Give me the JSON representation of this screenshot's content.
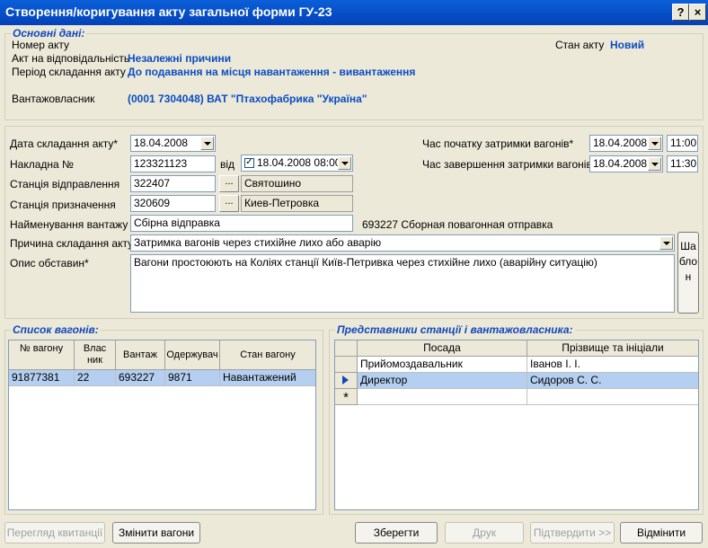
{
  "window": {
    "title": "Створення/коригування акту загальної форми ГУ-23",
    "help_label": "?",
    "close_label": "×"
  },
  "main_info": {
    "legend": "Основні дані:",
    "act_number_label": "Номер акту",
    "act_state_label": "Стан акту",
    "act_state_value": "Новий",
    "responsibility_label": "Акт на відповідальність",
    "responsibility_value": "Незалежні причини",
    "period_label": "Період складання акту",
    "period_value": "До подавання на місця навантаження - вивантаження",
    "cargo_owner_label": "Вантажовласник",
    "cargo_owner_value": "(0001 7304048) ВАТ \"Птахофабрика \"Україна\""
  },
  "form": {
    "date_label": "Дата складання акту*",
    "date_value": "18.04.2008",
    "invoice_label": "Накладна №",
    "invoice_value": "123321123",
    "from_label": "від",
    "invoice_date_value": "18.04.2008 08:00",
    "departure_label": "Станція відправлення",
    "departure_code": "322407",
    "departure_name": "Святошино",
    "destination_label": "Станція призначення",
    "destination_code": "320609",
    "destination_name": "Киев-Петровка",
    "cargo_name_label": "Найменування вантажу",
    "cargo_name_value": "Сбірна відправка",
    "cargo_code_text": "693227 Сборная повагонная отправка",
    "reason_label": "Причина складання акту*",
    "reason_value": "Затримка вагонів  через стихійне лихо або аварію",
    "circumstances_label": "Опис обставин*",
    "circumstances_value": "Вагони простоюють на Коліях станції Київ-Петривка через стихійне лихо (аварійну ситуацію)",
    "template_button": "Шаблон",
    "delay_start_label": "Час початку затримки вагонів*",
    "delay_start_date": "18.04.2008",
    "delay_start_time": "11:00",
    "delay_end_label": "Час завершення затримки вагонів*",
    "delay_end_date": "18.04.2008",
    "delay_end_time": "11:30",
    "browse_label": "..."
  },
  "wagons": {
    "legend": "Список вагонів:",
    "columns": [
      "№ вагону",
      "Влас ник",
      "Вантаж",
      "Одержувач",
      "Стан вагону"
    ],
    "rows": [
      [
        "91877381",
        "22",
        "693227",
        "9871",
        "Навантажений"
      ]
    ]
  },
  "representatives": {
    "legend": "Представники станції і вантажовласника:",
    "columns": [
      "Посада",
      "Прізвище та ініціали"
    ],
    "rows": [
      [
        "Прийомоздавальник",
        "Іванов І. І."
      ],
      [
        "Директор",
        "Сидоров С. С."
      ]
    ],
    "new_row_marker": "*"
  },
  "buttons": {
    "view_receipt": "Перегляд квитанції",
    "change_wagons": "Змінити вагони",
    "save": "Зберегти",
    "print": "Друк",
    "confirm": "Підтвердити >>",
    "cancel": "Відмінити"
  },
  "colors": {
    "accent": "#0B4DC3",
    "titlebar": "#0A5FD8",
    "selected_row": "#B4CFF0"
  }
}
